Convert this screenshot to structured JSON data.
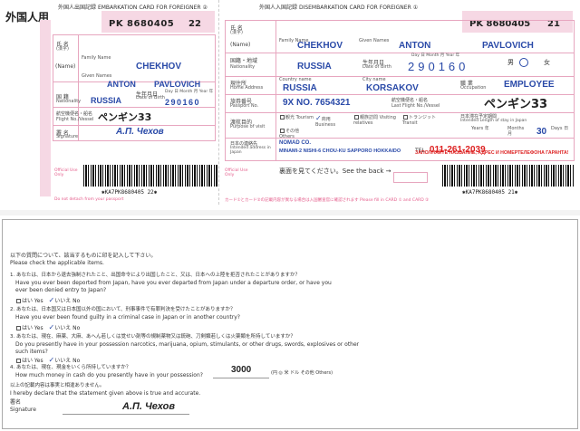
{
  "left_card": {
    "side_label": "外国人用",
    "header_jp": "外国人出国記録",
    "header_en": "EMBARKATION CARD FOR FOREIGNER",
    "header_num": "②",
    "passport_no": "PK 8680405",
    "card_no": "22",
    "name_label_jp": "氏 名",
    "name_label_sub": "(漢字)",
    "name_label_en": "(Name)",
    "family_name_label": "Family Name",
    "family_name": "CHEKHOV",
    "given_names_label": "Given Names",
    "given_name": "ANTON",
    "middle_name": "PAVLOVICH",
    "nationality_label_jp": "国 籍",
    "nationality_label_en": "Nationality",
    "nationality": "RUSSIA",
    "dob_label_jp": "生年月日",
    "dob_label_en": "Date of Birth",
    "dob_cols": "Day 日 Month 月 Year 年",
    "dob": "290160",
    "flight_label_jp": "航空機便名・船名",
    "flight_label_en": "Flight No./Vessel",
    "flight": "ペンギン33",
    "sign_label_jp": "署 名",
    "sign_label_en": "Signature",
    "signature": "А.П. Чехов",
    "barcode_text": "✱KA7PK8680405 22✱",
    "footer_text": "Do not detach from your passport",
    "office_use": "Official Use Only"
  },
  "right_card": {
    "header_jp": "外国人入国記録",
    "header_en": "DISEMBARKATION CARD FOR FOREIGNER",
    "header_num": "①",
    "passport_no": "PK 8680405",
    "card_no": "21",
    "name_label_jp": "氏 名",
    "name_label_sub": "(漢字)",
    "name_label_en": "(Name)",
    "family_name_label": "Family Name",
    "family_name": "CHEKHOV",
    "given_names_label": "Given Names",
    "given_name": "ANTON",
    "middle_name": "PAVLOVICH",
    "nationality_label_jp": "国籍・地域",
    "nationality_label_en": "Nationality",
    "nationality": "RUSSIA",
    "dob_label_jp": "生年月日",
    "dob_label_en": "Date of Birth",
    "dob_cols": "Day 日 Month 月 Year 年",
    "dob": "290160",
    "sex_label": "男",
    "sex_female": "女",
    "home_label_jp": "現住所",
    "home_label_en": "Home Address",
    "country_label": "Country name",
    "country": "RUSSIA",
    "city_label": "City name",
    "city": "KORSAKOV",
    "occupation_label_jp": "職 業",
    "occupation_label_en": "Occupation",
    "occupation": "EMPLOYEE",
    "passport_label_jp": "旅券番号",
    "passport_label_en": "Passport No.",
    "passport": "9X NO. 7654321",
    "last_flight_label_jp": "航空機便名・船名",
    "last_flight_label_en": "Last Flight No./Vessel",
    "last_flight": "ペンギン33",
    "purpose_label_jp": "渡航目的",
    "purpose_label_en": "Purpose of visit",
    "purpose_tourism": "観光 Tourism",
    "purpose_business": "商用 Business",
    "purpose_relatives": "親族訪問 Visiting relatives",
    "purpose_transit": "トランジット Transit",
    "purpose_others": "その他 Others",
    "stay_label_jp": "日本滞在予定期間",
    "stay_label_en": "Intended Length of stay in Japan",
    "stay_years": "Years 年",
    "stay_months": "Months 月",
    "stay_days_label": "Days 日",
    "stay_days": "30",
    "contact_label_jp": "日本の連絡先",
    "contact_label_en": "Intended address in Japan",
    "contact_line1": "NOMAD CO.",
    "contact_line2": "MINAMI-2 NISHI-6 CHOU-KU SAPPORO HOKKAIDO",
    "tel_label": "TEL",
    "tel": "011-261-2039",
    "red_note": "ЗАПОЛНЯЙТЕ НАЗВАНИЕ, АДРЕС И НОМЕРТЕЛЕФОНА ГАРАНТА!",
    "see_back": "裏面を見てください。See the back →",
    "barcode_text": "✱KA7PK8680405 21✱",
    "footer_text": "カード①とカード②の記載内容が異なる場合は入国審査官に確認されます Please fill in CARD ① and CARD ②",
    "office_use": "Official Use Only"
  },
  "back_card": {
    "intro_jp": "以下の質問について、該当するものに印を記入して下さい。",
    "intro_en": "Please check the applicable items.",
    "q1_jp": "1. あなたは、日本から退去強制されたこと、出国命令により出国したこと、又は、日本への上陸を拒否されたことがありますか？",
    "q1_en": "Have you ever been deported from Japan, have you ever departed from Japan under a departure order, or have you ever been denied entry to Japan?",
    "q2_jp": "2. あなたは、日本国又は日本国以外の国において、刑事事件で有罪判決を受けたことがありますか？",
    "q2_en": "Have you ever been found guilty in a criminal case in Japan or in another country?",
    "q3_jp": "3. あなたは、現在、麻薬、大麻、あへん若しくは覚せい剤等の規制薬物又は銃砲、刀剣類若しくは火薬類を所持していますか？",
    "q3_en": "Do you presently have in your possession narcotics, marijuana, opium, stimulants, or other drugs, swords, explosives or other such items?",
    "q4_jp": "4. あなたは、現在、現金をいくら所持していますか？",
    "q4_en": "How much money in cash do you presently have in your possession?",
    "yes_label": "はい Yes",
    "no_label": "いいえ No",
    "money": "3000",
    "money_unit": "(円 ◎ 米 ドル その他 Others)",
    "declare_jp": "以上の記載内容は事実と相違ありません。",
    "declare_en": "I hereby declare that the statement given above is true and accurate.",
    "sign_label_jp": "署名",
    "sign_label_en": "Signature",
    "signature": "А.П. Чехов"
  }
}
